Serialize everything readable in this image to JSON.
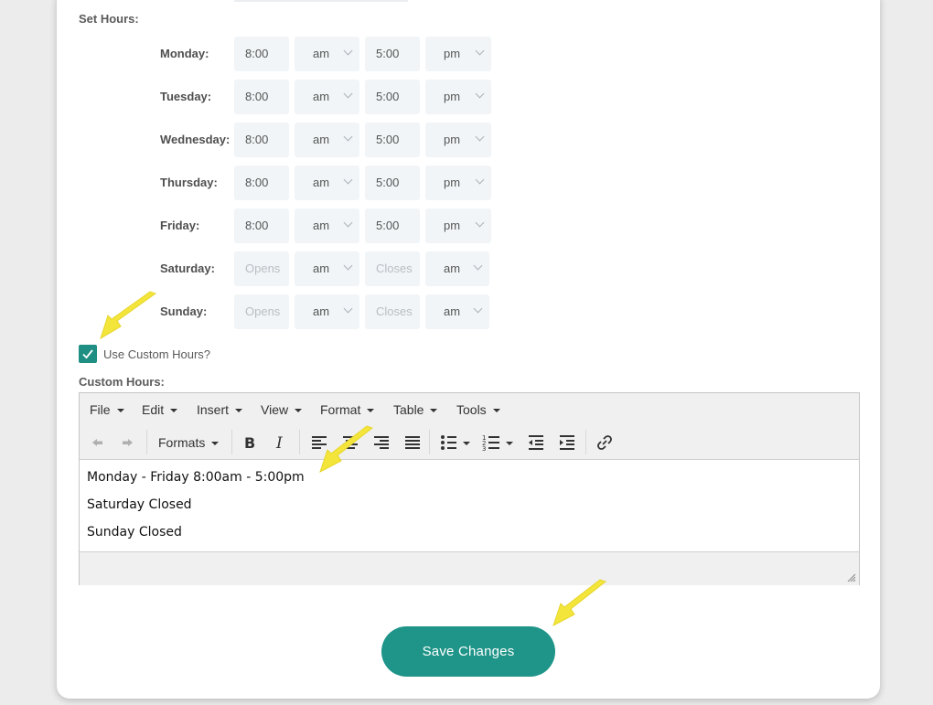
{
  "hours": {
    "section_label": "Set Hours:",
    "days": [
      {
        "day": "Monday:",
        "open": "8:00",
        "open_ampm": "am",
        "close": "5:00",
        "close_ampm": "pm"
      },
      {
        "day": "Tuesday:",
        "open": "8:00",
        "open_ampm": "am",
        "close": "5:00",
        "close_ampm": "pm"
      },
      {
        "day": "Wednesday:",
        "open": "8:00",
        "open_ampm": "am",
        "close": "5:00",
        "close_ampm": "pm"
      },
      {
        "day": "Thursday:",
        "open": "8:00",
        "open_ampm": "am",
        "close": "5:00",
        "close_ampm": "pm"
      },
      {
        "day": "Friday:",
        "open": "8:00",
        "open_ampm": "am",
        "close": "5:00",
        "close_ampm": "pm"
      },
      {
        "day": "Saturday:",
        "open_placeholder": "Opens",
        "open_ampm": "am",
        "close_placeholder": "Closes",
        "close_ampm": "am"
      },
      {
        "day": "Sunday:",
        "open_placeholder": "Opens",
        "open_ampm": "am",
        "close_placeholder": "Closes",
        "close_ampm": "am"
      }
    ]
  },
  "custom": {
    "checkbox_label": "Use Custom Hours?",
    "checked": true,
    "section_label": "Custom Hours:"
  },
  "editor": {
    "menus": [
      "File",
      "Edit",
      "Insert",
      "View",
      "Format",
      "Table",
      "Tools"
    ],
    "formats_label": "Formats",
    "lines": [
      "Monday - Friday 8:00am - 5:00pm",
      "Saturday Closed",
      "Sunday Closed"
    ]
  },
  "save_label": "Save Changes",
  "colors": {
    "accent": "#1f9488",
    "arrow": "#f5e63a"
  }
}
